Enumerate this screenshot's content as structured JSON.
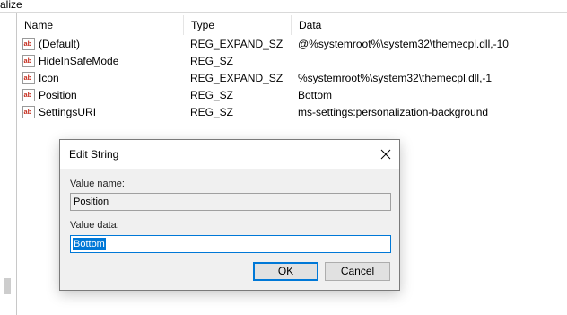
{
  "window": {
    "path_fragment": "alize"
  },
  "columns": {
    "name": "Name",
    "type": "Type",
    "data": "Data"
  },
  "rows": [
    {
      "name": "(Default)",
      "type": "REG_EXPAND_SZ",
      "data": "@%systemroot%\\system32\\themecpl.dll,-10"
    },
    {
      "name": "HideInSafeMode",
      "type": "REG_SZ",
      "data": ""
    },
    {
      "name": "Icon",
      "type": "REG_EXPAND_SZ",
      "data": "%systemroot%\\system32\\themecpl.dll,-1"
    },
    {
      "name": "Position",
      "type": "REG_SZ",
      "data": "Bottom"
    },
    {
      "name": "SettingsURI",
      "type": "REG_SZ",
      "data": "ms-settings:personalization-background"
    }
  ],
  "icons": {
    "value": "reg-string-icon",
    "close": "close-icon"
  },
  "colors": {
    "accent": "#0078d7",
    "icon_red": "#c42b1c"
  },
  "dialog": {
    "title": "Edit String",
    "value_name_label": "Value name:",
    "value_name": "Position",
    "value_data_label": "Value data:",
    "value_data": "Bottom",
    "ok_label": "OK",
    "cancel_label": "Cancel"
  }
}
